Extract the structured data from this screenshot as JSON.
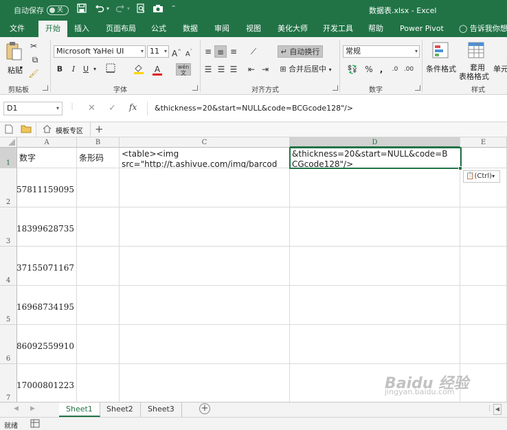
{
  "titlebar": {
    "autosave_label": "自动保存",
    "autosave_state": "关",
    "file_title": "数据表.xlsx - Excel",
    "save_icon": "save-icon",
    "undo_icon": "undo-icon",
    "redo_icon": "redo-icon"
  },
  "tabs": [
    "文件",
    "开始",
    "插入",
    "页面布局",
    "公式",
    "数据",
    "审阅",
    "视图",
    "美化大师",
    "开发工具",
    "帮助",
    "Power Pivot",
    "告诉我你想要"
  ],
  "active_tab": "开始",
  "ribbon": {
    "paste_label": "粘贴",
    "clipboard_label": "剪贴板",
    "font_name": "Microsoft YaHei UI",
    "font_size": "11",
    "font_group_label": "字体",
    "wrap_text_label": "自动换行",
    "merge_center_label": "合并后居中",
    "alignment_group_label": "对齐方式",
    "number_format": "常规",
    "number_group_label": "数字",
    "conditional_format_label": "条件格式",
    "table_format_label_1": "套用",
    "table_format_label_2": "表格格式",
    "cell_styles_label": "单元",
    "styles_group_label": "样式",
    "bold": "B",
    "italic": "I",
    "underline": "U",
    "grow_font": "A",
    "shrink_font": "A",
    "phonetic": "wén",
    "percent": "%",
    "comma": ","
  },
  "formula_bar": {
    "name_box": "D1",
    "formula": "&thickness=20&start=NULL&code=BCGcode128\"/>"
  },
  "quickbar": {
    "template_label": "模板专区",
    "add_label": "+"
  },
  "columns": [
    {
      "label": "A"
    },
    {
      "label": "B"
    },
    {
      "label": "C"
    },
    {
      "label": "D"
    },
    {
      "label": "E"
    }
  ],
  "rows": [
    {
      "num": "1",
      "A": "数字",
      "B": "条形码",
      "C_line1": "<table><img",
      "C_line2": "src=\"http://t.ashivue.com/img/barcod",
      "D_line1": "&thickness=20&start=NULL&code=B",
      "D_line2": "CGcode128\"/>"
    },
    {
      "num": "2",
      "A": "57811159095"
    },
    {
      "num": "3",
      "A": "18399628735"
    },
    {
      "num": "4",
      "A": "37155071167"
    },
    {
      "num": "5",
      "A": "16968734195"
    },
    {
      "num": "6",
      "A": "86092559910"
    },
    {
      "num": "7",
      "A": "17000801223"
    }
  ],
  "paste_options": "(Ctrl)",
  "sheets": [
    "Sheet1",
    "Sheet2",
    "Sheet3"
  ],
  "active_sheet": "Sheet1",
  "status": {
    "ready": "就绪"
  },
  "watermark": {
    "brand": "Baidu 经验",
    "url": "jingyan.baidu.com"
  },
  "colors": {
    "excel_green": "#217346",
    "ribbon_bg": "#f3f3f3"
  }
}
